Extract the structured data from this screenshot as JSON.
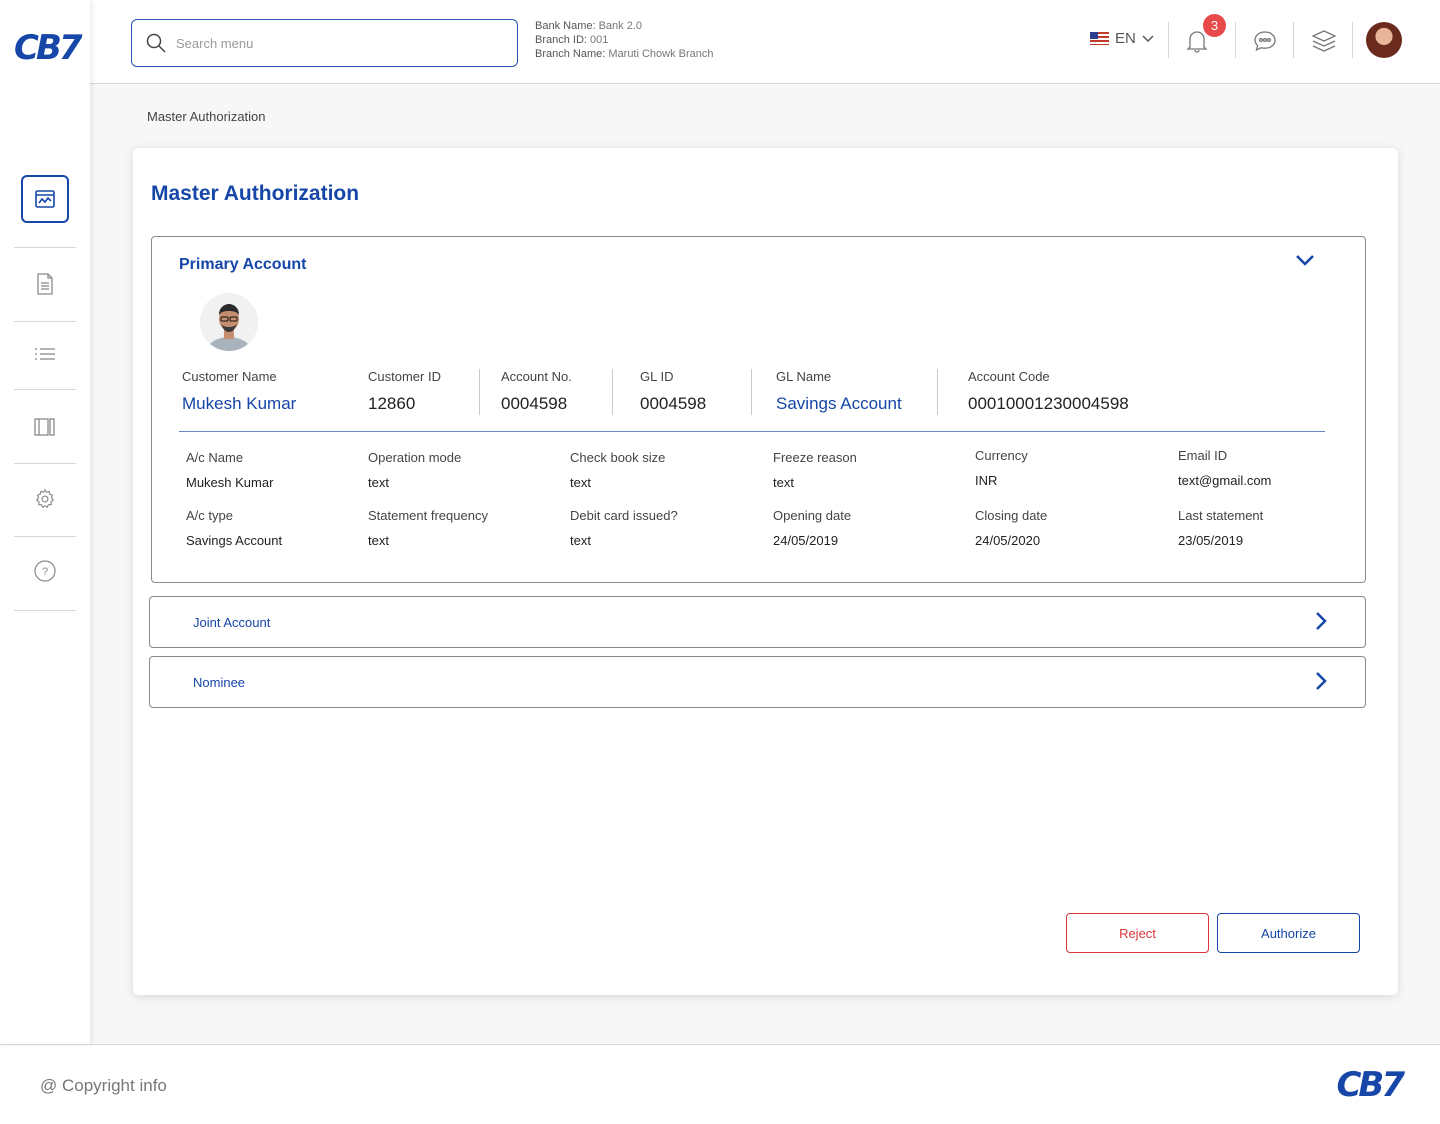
{
  "app": {
    "logo": "CB7",
    "footer_logo": "CB7",
    "accent": "#1546a8",
    "danger": "#d9363e"
  },
  "header": {
    "search_placeholder": "Search menu",
    "bank_name_label": "Bank Name:",
    "bank_name": "Bank 2.0",
    "branch_id_label": "Branch ID:",
    "branch_id": "001",
    "branch_name_label": "Branch Name:",
    "branch_name": "Maruti Chowk Branch",
    "language": "EN",
    "notification_count": "3"
  },
  "sidebar": {
    "items": [
      {
        "icon": "dashboard-icon",
        "active": true
      },
      {
        "icon": "document-icon"
      },
      {
        "icon": "list-icon"
      },
      {
        "icon": "columns-icon"
      },
      {
        "icon": "gear-icon"
      },
      {
        "icon": "help-icon"
      }
    ]
  },
  "breadcrumb": "Master Authorization",
  "card": {
    "title": "Master Authorization",
    "primary": {
      "title": "Primary Account",
      "summary": [
        {
          "label": "Customer Name",
          "value": "Mukesh Kumar"
        },
        {
          "label": "Customer ID",
          "value": "12860"
        },
        {
          "label": "Account No.",
          "value": "0004598"
        },
        {
          "label": "GL ID",
          "value": "0004598"
        },
        {
          "label": "GL Name",
          "value": "Savings Account"
        },
        {
          "label": "Account Code",
          "value": "00010001230004598"
        }
      ],
      "details": [
        {
          "label": "A/c Name",
          "value": "Mukesh Kumar"
        },
        {
          "label": "Operation mode",
          "value": "text"
        },
        {
          "label": "Check book size",
          "value": "text"
        },
        {
          "label": "Freeze reason",
          "value": "text"
        },
        {
          "label": "Currency",
          "value": "INR"
        },
        {
          "label": "Email ID",
          "value": "text@gmail.com"
        },
        {
          "label": "A/c type",
          "value": "Savings Account"
        },
        {
          "label": "Statement frequency",
          "value": "text"
        },
        {
          "label": "Debit card issued?",
          "value": "text"
        },
        {
          "label": "Opening date",
          "value": "24/05/2019"
        },
        {
          "label": "Closing date",
          "value": "24/05/2020"
        },
        {
          "label": "Last statement",
          "value": "23/05/2019"
        }
      ]
    },
    "joint_account": "Joint Account",
    "nominee": "Nominee",
    "reject_label": "Reject",
    "authorize_label": "Authorize"
  },
  "footer": {
    "copyright": "@ Copyright info"
  }
}
